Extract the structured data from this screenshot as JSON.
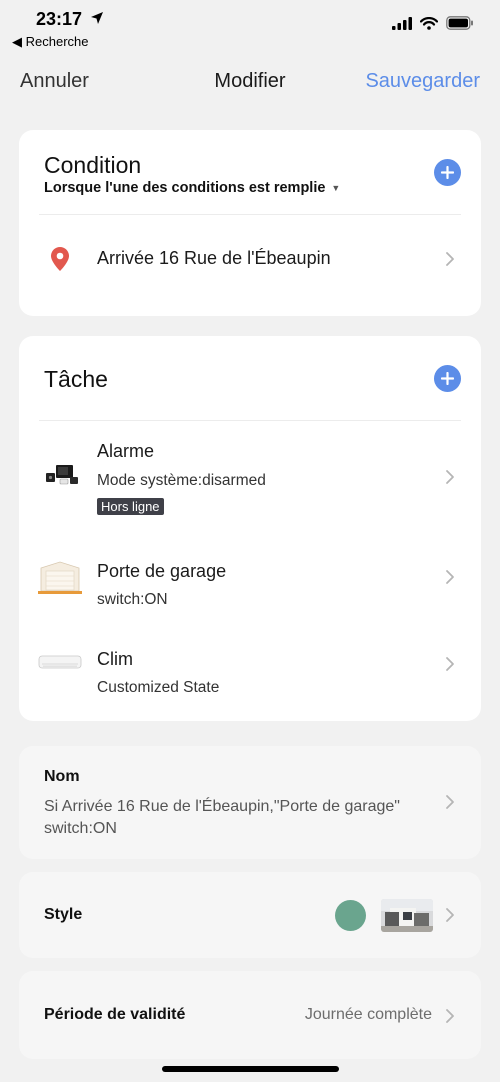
{
  "status": {
    "time": "23:17",
    "back_app": "◀ Recherche"
  },
  "nav": {
    "cancel": "Annuler",
    "title": "Modifier",
    "save": "Sauvegarder"
  },
  "condition": {
    "title": "Condition",
    "subtitle": "Lorsque l'une des conditions est remplie",
    "items": [
      {
        "label": "Arrivée 16 Rue de l'Ébeaupin",
        "icon": "location-pin-icon"
      }
    ]
  },
  "task": {
    "title": "Tâche",
    "devices": [
      {
        "name": "Alarme",
        "state": "Mode système:disarmed",
        "badge": "Hors ligne"
      },
      {
        "name": "Porte de garage",
        "state": "switch:ON"
      },
      {
        "name": "Clim",
        "state": "Customized State"
      }
    ]
  },
  "name_section": {
    "label": "Nom",
    "value": "Si Arrivée 16 Rue de l'Ébeaupin,\"Porte de garage\" switch:ON"
  },
  "style_section": {
    "label": "Style",
    "color": "#6aa58e"
  },
  "period_section": {
    "label": "Période de validité",
    "value": "Journée complète"
  },
  "colors": {
    "accent": "#5c8de8",
    "pin": "#e2584e"
  }
}
